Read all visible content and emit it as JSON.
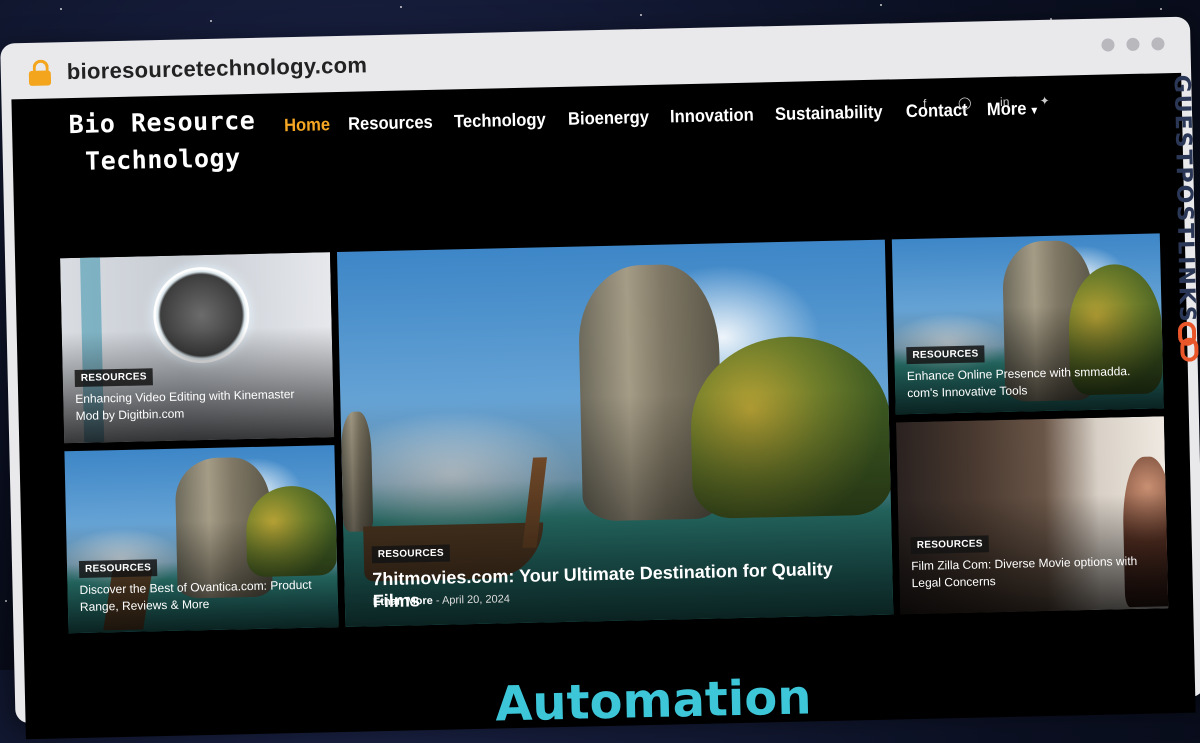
{
  "browser": {
    "url": "bioresourcetechnology.com"
  },
  "site": {
    "logo": [
      "Bio Resource",
      "Technology"
    ],
    "nav": [
      "Home",
      "Resources",
      "Technology",
      "Bioenergy",
      "Innovation",
      "Sustainability",
      "Contact",
      "More"
    ],
    "active_nav": "Home",
    "socials": [
      "facebook-icon",
      "instagram-icon",
      "linkedin-icon",
      "twitter-icon"
    ]
  },
  "cards": {
    "top_left": {
      "category": "RESOURCES",
      "title": "Enhancing Video Editing with Kinemaster Mod by Digitbin.com"
    },
    "bottom_left": {
      "category": "RESOURCES",
      "title": "Discover the Best of Ovantica.com: Product Range, Reviews & More"
    },
    "main": {
      "category": "RESOURCES",
      "title": "7hitmovies.com: Your Ultimate Destination for Quality Films",
      "author": "Ethan More",
      "separator": "-",
      "date": "April 20, 2024"
    },
    "top_right": {
      "category": "RESOURCES",
      "title": "Enhance Online Presence with smmadda. com's Innovative Tools"
    },
    "bottom_right": {
      "category": "RESOURCES",
      "title": "Film Zilla Com: Diverse Movie options with Legal Concerns"
    }
  },
  "section_heading": "Automation",
  "watermark": "GUESTPOSTLINKS",
  "colors": {
    "accent": "#f5a623",
    "heading": "#3cc6d8",
    "lock": "#f3a51e"
  }
}
